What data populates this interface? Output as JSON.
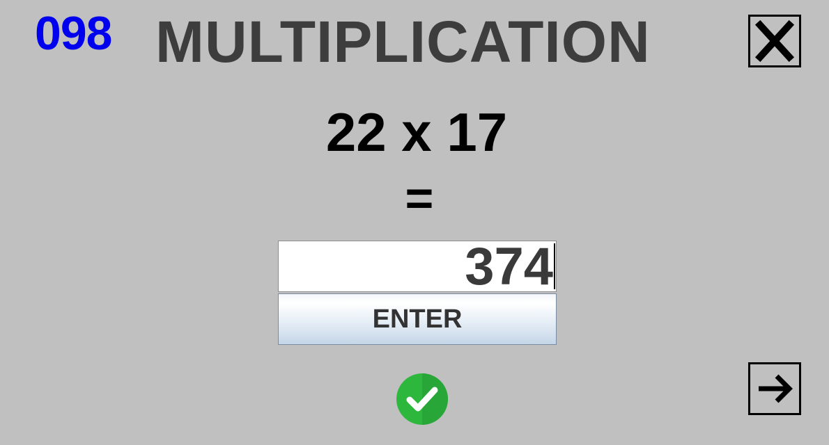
{
  "header": {
    "counter": "098",
    "counter_color": "#0000ee",
    "title": "MULTIPLICATION",
    "close_icon": "close-x-icon"
  },
  "problem": {
    "expression": "22 x 17",
    "equals": "="
  },
  "answer": {
    "value": "374"
  },
  "enter": {
    "label": "ENTER"
  },
  "feedback": {
    "icon": "check-circle-icon",
    "color": "#2db83d"
  },
  "navigation": {
    "next_icon": "arrow-right-icon"
  }
}
